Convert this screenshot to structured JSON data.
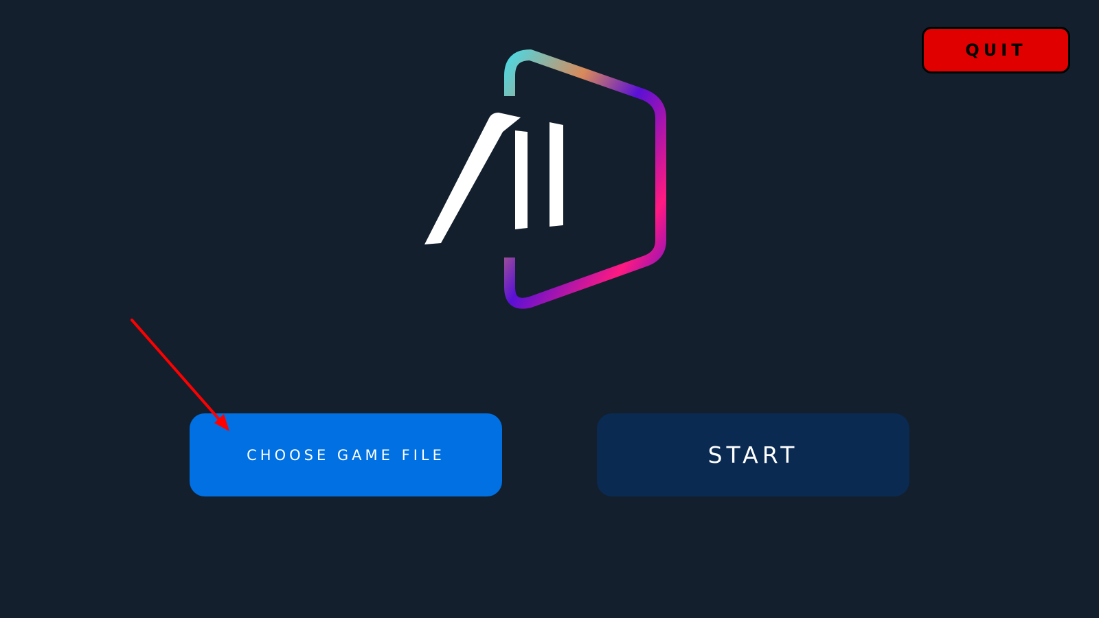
{
  "header": {
    "quit_label": "QUIT"
  },
  "logo": {
    "text": "AI",
    "icon": "ai-logo-icon",
    "gradient_colors": [
      "#4fd6e0",
      "#d98a5a",
      "#5a10d6",
      "#ff1a80",
      "#6a10d0"
    ]
  },
  "actions": {
    "choose_label": "CHOOSE GAME FILE",
    "start_label": "START"
  },
  "annotation": {
    "icon": "red-arrow-icon",
    "color": "#ff0000"
  },
  "colors": {
    "background": "#131f2d",
    "quit": "#e00000",
    "choose": "#0070e3",
    "start": "#0a2a52"
  }
}
